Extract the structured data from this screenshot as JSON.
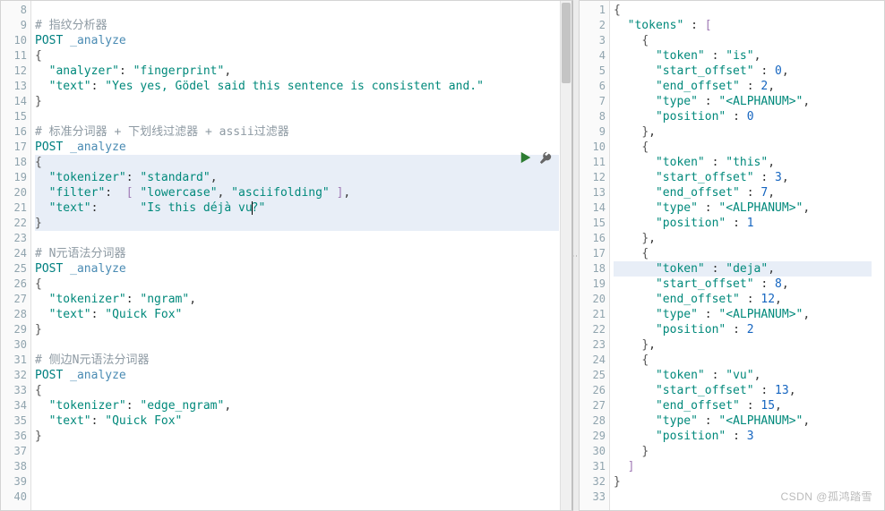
{
  "watermark": "CSDN @孤鸿踏雪",
  "left": {
    "start": 8,
    "selStart": 18,
    "selEnd": 22,
    "curLine": 21,
    "lines": [
      [],
      [
        {
          "t": "# 指纹分析器",
          "c": "c-comment"
        }
      ],
      [
        {
          "t": "POST ",
          "c": "c-key"
        },
        {
          "t": "_analyze",
          "c": "c-name"
        }
      ],
      [
        {
          "t": "{",
          "c": "c-brace"
        }
      ],
      [
        {
          "t": "  "
        },
        {
          "t": "\"analyzer\"",
          "c": "c-str"
        },
        {
          "t": ": "
        },
        {
          "t": "\"fingerprint\"",
          "c": "c-str"
        },
        {
          "t": ","
        }
      ],
      [
        {
          "t": "  "
        },
        {
          "t": "\"text\"",
          "c": "c-str"
        },
        {
          "t": ": "
        },
        {
          "t": "\"Yes yes, Gödel said this sentence is consistent and.\"",
          "c": "c-str"
        }
      ],
      [
        {
          "t": "}",
          "c": "c-brace"
        }
      ],
      [],
      [
        {
          "t": "# 标准分词器 + 下划线过滤器 + assii过滤器",
          "c": "c-comment"
        }
      ],
      [
        {
          "t": "POST ",
          "c": "c-key"
        },
        {
          "t": "_analyze",
          "c": "c-name"
        }
      ],
      [
        {
          "t": "{",
          "c": "c-brace"
        }
      ],
      [
        {
          "t": "  "
        },
        {
          "t": "\"tokenizer\"",
          "c": "c-str"
        },
        {
          "t": ": "
        },
        {
          "t": "\"standard\"",
          "c": "c-str"
        },
        {
          "t": ","
        }
      ],
      [
        {
          "t": "  "
        },
        {
          "t": "\"filter\"",
          "c": "c-str"
        },
        {
          "t": ":  "
        },
        {
          "t": "[ ",
          "c": "c-bracket"
        },
        {
          "t": "\"lowercase\"",
          "c": "c-str"
        },
        {
          "t": ", "
        },
        {
          "t": "\"asciifolding\"",
          "c": "c-str"
        },
        {
          "t": " ]",
          "c": "c-bracket"
        },
        {
          "t": ","
        }
      ],
      [
        {
          "t": "  "
        },
        {
          "t": "\"text\"",
          "c": "c-str"
        },
        {
          "t": ":      "
        },
        {
          "t": "\"Is this déjà vu",
          "c": "c-str"
        },
        {
          "t": "",
          "cursor": true
        },
        {
          "t": "?\"",
          "c": "c-str"
        }
      ],
      [
        {
          "t": "}",
          "c": "c-brace"
        }
      ],
      [],
      [
        {
          "t": "# N元语法分词器",
          "c": "c-comment"
        }
      ],
      [
        {
          "t": "POST ",
          "c": "c-key"
        },
        {
          "t": "_analyze",
          "c": "c-name"
        }
      ],
      [
        {
          "t": "{",
          "c": "c-brace"
        }
      ],
      [
        {
          "t": "  "
        },
        {
          "t": "\"tokenizer\"",
          "c": "c-str"
        },
        {
          "t": ": "
        },
        {
          "t": "\"ngram\"",
          "c": "c-str"
        },
        {
          "t": ","
        }
      ],
      [
        {
          "t": "  "
        },
        {
          "t": "\"text\"",
          "c": "c-str"
        },
        {
          "t": ": "
        },
        {
          "t": "\"Quick Fox\"",
          "c": "c-str"
        }
      ],
      [
        {
          "t": "}",
          "c": "c-brace"
        }
      ],
      [],
      [
        {
          "t": "# 侧边N元语法分词器",
          "c": "c-comment"
        }
      ],
      [
        {
          "t": "POST ",
          "c": "c-key"
        },
        {
          "t": "_analyze",
          "c": "c-name"
        }
      ],
      [
        {
          "t": "{",
          "c": "c-brace"
        }
      ],
      [
        {
          "t": "  "
        },
        {
          "t": "\"tokenizer\"",
          "c": "c-str"
        },
        {
          "t": ": "
        },
        {
          "t": "\"edge_ngram\"",
          "c": "c-str"
        },
        {
          "t": ","
        }
      ],
      [
        {
          "t": "  "
        },
        {
          "t": "\"text\"",
          "c": "c-str"
        },
        {
          "t": ": "
        },
        {
          "t": "\"Quick Fox\"",
          "c": "c-str"
        }
      ],
      [
        {
          "t": "}",
          "c": "c-brace"
        }
      ],
      [],
      [],
      [],
      []
    ]
  },
  "right": {
    "start": 1,
    "highlight": 18,
    "lines": [
      [
        {
          "t": "{",
          "c": "c-brace"
        }
      ],
      [
        {
          "t": "  "
        },
        {
          "t": "\"tokens\"",
          "c": "c-str"
        },
        {
          "t": " : "
        },
        {
          "t": "[",
          "c": "c-bracket"
        }
      ],
      [
        {
          "t": "    "
        },
        {
          "t": "{",
          "c": "c-brace"
        }
      ],
      [
        {
          "t": "      "
        },
        {
          "t": "\"token\"",
          "c": "c-str"
        },
        {
          "t": " : "
        },
        {
          "t": "\"is\"",
          "c": "c-str"
        },
        {
          "t": ","
        }
      ],
      [
        {
          "t": "      "
        },
        {
          "t": "\"start_offset\"",
          "c": "c-str"
        },
        {
          "t": " : "
        },
        {
          "t": "0",
          "c": "c-num"
        },
        {
          "t": ","
        }
      ],
      [
        {
          "t": "      "
        },
        {
          "t": "\"end_offset\"",
          "c": "c-str"
        },
        {
          "t": " : "
        },
        {
          "t": "2",
          "c": "c-num"
        },
        {
          "t": ","
        }
      ],
      [
        {
          "t": "      "
        },
        {
          "t": "\"type\"",
          "c": "c-str"
        },
        {
          "t": " : "
        },
        {
          "t": "\"<ALPHANUM>\"",
          "c": "c-str"
        },
        {
          "t": ","
        }
      ],
      [
        {
          "t": "      "
        },
        {
          "t": "\"position\"",
          "c": "c-str"
        },
        {
          "t": " : "
        },
        {
          "t": "0",
          "c": "c-num"
        }
      ],
      [
        {
          "t": "    "
        },
        {
          "t": "}",
          "c": "c-brace"
        },
        {
          "t": ","
        }
      ],
      [
        {
          "t": "    "
        },
        {
          "t": "{",
          "c": "c-brace"
        }
      ],
      [
        {
          "t": "      "
        },
        {
          "t": "\"token\"",
          "c": "c-str"
        },
        {
          "t": " : "
        },
        {
          "t": "\"this\"",
          "c": "c-str"
        },
        {
          "t": ","
        }
      ],
      [
        {
          "t": "      "
        },
        {
          "t": "\"start_offset\"",
          "c": "c-str"
        },
        {
          "t": " : "
        },
        {
          "t": "3",
          "c": "c-num"
        },
        {
          "t": ","
        }
      ],
      [
        {
          "t": "      "
        },
        {
          "t": "\"end_offset\"",
          "c": "c-str"
        },
        {
          "t": " : "
        },
        {
          "t": "7",
          "c": "c-num"
        },
        {
          "t": ","
        }
      ],
      [
        {
          "t": "      "
        },
        {
          "t": "\"type\"",
          "c": "c-str"
        },
        {
          "t": " : "
        },
        {
          "t": "\"<ALPHANUM>\"",
          "c": "c-str"
        },
        {
          "t": ","
        }
      ],
      [
        {
          "t": "      "
        },
        {
          "t": "\"position\"",
          "c": "c-str"
        },
        {
          "t": " : "
        },
        {
          "t": "1",
          "c": "c-num"
        }
      ],
      [
        {
          "t": "    "
        },
        {
          "t": "}",
          "c": "c-brace"
        },
        {
          "t": ","
        }
      ],
      [
        {
          "t": "    "
        },
        {
          "t": "{",
          "c": "c-brace"
        }
      ],
      [
        {
          "t": "      "
        },
        {
          "t": "\"token\"",
          "c": "c-str"
        },
        {
          "t": " : "
        },
        {
          "t": "\"deja\"",
          "c": "c-str"
        },
        {
          "t": ","
        }
      ],
      [
        {
          "t": "      "
        },
        {
          "t": "\"start_offset\"",
          "c": "c-str"
        },
        {
          "t": " : "
        },
        {
          "t": "8",
          "c": "c-num"
        },
        {
          "t": ","
        }
      ],
      [
        {
          "t": "      "
        },
        {
          "t": "\"end_offset\"",
          "c": "c-str"
        },
        {
          "t": " : "
        },
        {
          "t": "12",
          "c": "c-num"
        },
        {
          "t": ","
        }
      ],
      [
        {
          "t": "      "
        },
        {
          "t": "\"type\"",
          "c": "c-str"
        },
        {
          "t": " : "
        },
        {
          "t": "\"<ALPHANUM>\"",
          "c": "c-str"
        },
        {
          "t": ","
        }
      ],
      [
        {
          "t": "      "
        },
        {
          "t": "\"position\"",
          "c": "c-str"
        },
        {
          "t": " : "
        },
        {
          "t": "2",
          "c": "c-num"
        }
      ],
      [
        {
          "t": "    "
        },
        {
          "t": "}",
          "c": "c-brace"
        },
        {
          "t": ","
        }
      ],
      [
        {
          "t": "    "
        },
        {
          "t": "{",
          "c": "c-brace"
        }
      ],
      [
        {
          "t": "      "
        },
        {
          "t": "\"token\"",
          "c": "c-str"
        },
        {
          "t": " : "
        },
        {
          "t": "\"vu\"",
          "c": "c-str"
        },
        {
          "t": ","
        }
      ],
      [
        {
          "t": "      "
        },
        {
          "t": "\"start_offset\"",
          "c": "c-str"
        },
        {
          "t": " : "
        },
        {
          "t": "13",
          "c": "c-num"
        },
        {
          "t": ","
        }
      ],
      [
        {
          "t": "      "
        },
        {
          "t": "\"end_offset\"",
          "c": "c-str"
        },
        {
          "t": " : "
        },
        {
          "t": "15",
          "c": "c-num"
        },
        {
          "t": ","
        }
      ],
      [
        {
          "t": "      "
        },
        {
          "t": "\"type\"",
          "c": "c-str"
        },
        {
          "t": " : "
        },
        {
          "t": "\"<ALPHANUM>\"",
          "c": "c-str"
        },
        {
          "t": ","
        }
      ],
      [
        {
          "t": "      "
        },
        {
          "t": "\"position\"",
          "c": "c-str"
        },
        {
          "t": " : "
        },
        {
          "t": "3",
          "c": "c-num"
        }
      ],
      [
        {
          "t": "    "
        },
        {
          "t": "}",
          "c": "c-brace"
        }
      ],
      [
        {
          "t": "  "
        },
        {
          "t": "]",
          "c": "c-bracket"
        }
      ],
      [
        {
          "t": "}",
          "c": "c-brace"
        }
      ],
      []
    ]
  }
}
